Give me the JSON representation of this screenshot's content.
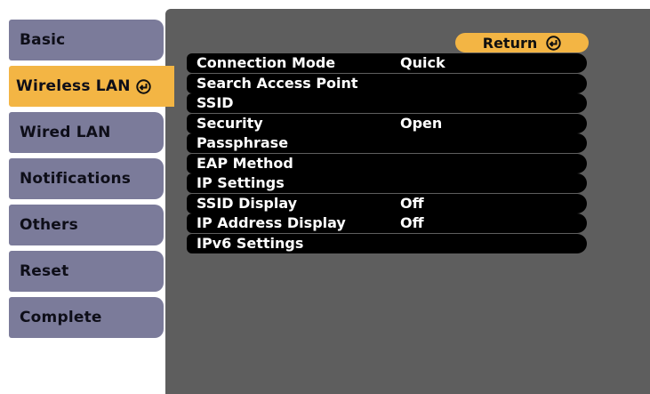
{
  "sidebar": {
    "items": [
      {
        "label": "Basic"
      },
      {
        "label": "Wireless LAN",
        "icon": "enter-icon"
      },
      {
        "label": "Wired LAN"
      },
      {
        "label": "Notifications"
      },
      {
        "label": "Others"
      },
      {
        "label": "Reset"
      },
      {
        "label": "Complete"
      }
    ]
  },
  "header": {
    "return_label": "Return",
    "return_icon": "enter-icon"
  },
  "settings": {
    "rows": [
      {
        "label": "Connection Mode",
        "value": "Quick"
      },
      {
        "label": "Search Access Point",
        "value": ""
      },
      {
        "label": "SSID",
        "value": ""
      },
      {
        "label": "Security",
        "value": "Open"
      },
      {
        "label": "Passphrase",
        "value": ""
      },
      {
        "label": "EAP Method",
        "value": ""
      },
      {
        "label": "IP Settings",
        "value": ""
      },
      {
        "label": "SSID Display",
        "value": "Off"
      },
      {
        "label": "IP Address Display",
        "value": "Off"
      },
      {
        "label": "IPv6 Settings",
        "value": ""
      }
    ]
  },
  "colors": {
    "accent": "#f3b544",
    "tab": "#7b7b9a",
    "panel": "#5e5e5e",
    "row": "#000000"
  }
}
